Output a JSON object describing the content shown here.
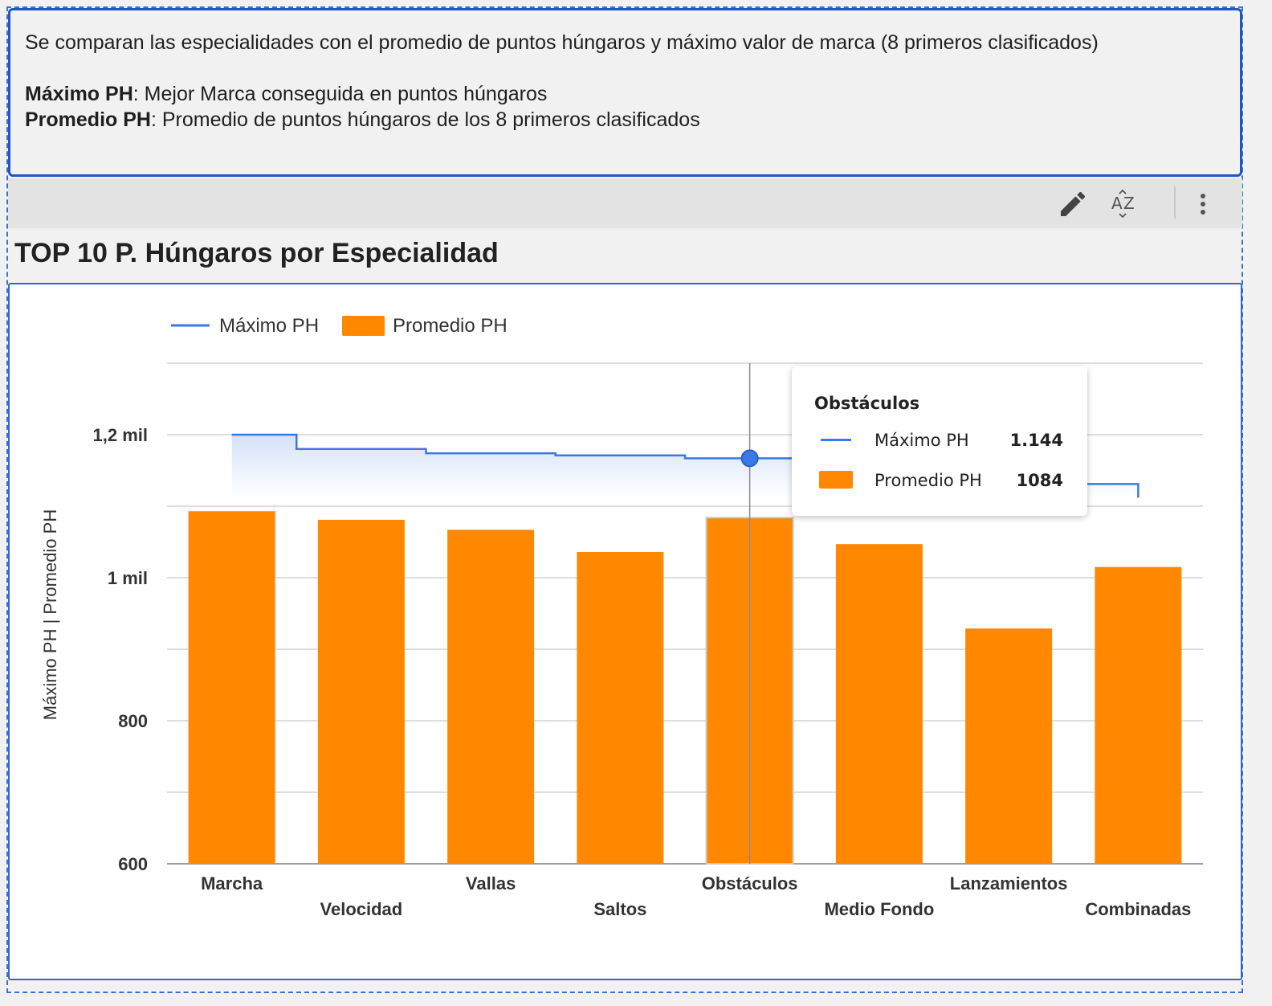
{
  "description": {
    "intro": "Se comparan las especialidades con el promedio de puntos húngaros y máximo valor de marca (8 primeros clasificados)",
    "def1_term": "Máximo PH",
    "def1_text": ": Mejor Marca conseguida en puntos húngaros",
    "def2_term": "Promedio PH",
    "def2_text": ": Promedio de puntos húngaros de los 8 primeros clasificados"
  },
  "toolbar": {
    "edit_icon": "pencil-icon",
    "sort_icon": "sort-az-icon",
    "more_icon": "more-vert-icon"
  },
  "chart_title": "TOP 10 P. Húngaros por Especialidad",
  "chart_data": {
    "type": "bar",
    "title": "TOP 10 P. Húngaros por Especialidad",
    "ylabel": "Máximo PH | Promedio PH",
    "xlabel": "",
    "ylim": [
      600,
      1300
    ],
    "yticks": [
      600,
      800,
      1000,
      1200
    ],
    "ytick_labels": [
      "600",
      "800",
      "1 mil",
      "1,2 mil"
    ],
    "categories": [
      "Marcha",
      "Velocidad",
      "Vallas",
      "Saltos",
      "Obstáculos",
      "Medio Fondo",
      "Lanzamientos",
      "Combinadas"
    ],
    "series": [
      {
        "name": "Máximo PH",
        "type": "stepped-line",
        "color": "#3b78e7",
        "values": [
          1200,
          1180,
          1174,
          1171,
          1167,
          1144,
          1141,
          1131
        ]
      },
      {
        "name": "Promedio PH",
        "type": "bar",
        "color": "#ff8800",
        "values": [
          1093,
          1081,
          1067,
          1036,
          1084,
          1047,
          929,
          1015
        ]
      }
    ],
    "legend_position": "top-left",
    "grid": true,
    "highlighted_category": "Obstáculos"
  },
  "tooltip": {
    "title": "Obstáculos",
    "rows": [
      {
        "label": "Máximo PH",
        "value": "1.144"
      },
      {
        "label": "Promedio PH",
        "value": "1084"
      }
    ]
  }
}
